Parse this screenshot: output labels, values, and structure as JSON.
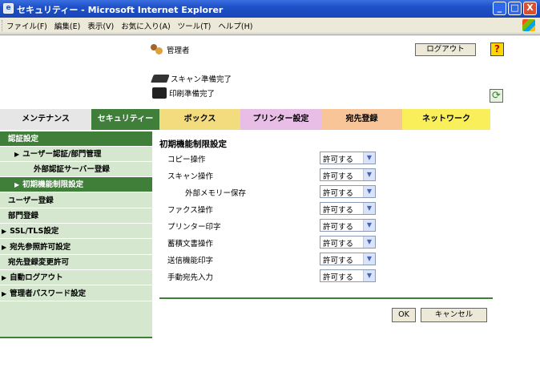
{
  "window": {
    "title": "セキュリティー - Microsoft Internet Explorer",
    "min": "_",
    "max": "□",
    "close": "X"
  },
  "menubar": [
    "ファイル(F)",
    "編集(E)",
    "表示(V)",
    "お気に入り(A)",
    "ツール(T)",
    "ヘルプ(H)"
  ],
  "header": {
    "user": "管理者",
    "logout_label": "ログアウト",
    "help_label": "?",
    "status_scan": "スキャン準備完了",
    "status_print": "印刷準備完了",
    "refresh_glyph": "⟳"
  },
  "tabs": [
    "メンテナンス",
    "セキュリティー",
    "ボックス",
    "プリンター設定",
    "宛先登録",
    "ネットワーク"
  ],
  "active_tab": "セキュリティー",
  "sidebar": [
    {
      "label": "認証設定",
      "dark": true,
      "arrow": ""
    },
    {
      "label": "ユーザー認証/部門管理",
      "dark": false,
      "arrow": "▶"
    },
    {
      "label": "外部認証サーバー登録",
      "dark": false,
      "arrow": ""
    },
    {
      "label": "初期機能制限設定",
      "dark": true,
      "arrow": "▶"
    },
    {
      "label": "ユーザー登録",
      "dark": false,
      "arrow": ""
    },
    {
      "label": "部門登録",
      "dark": false,
      "arrow": ""
    },
    {
      "label": "SSL/TLS設定",
      "dark": false,
      "arrow": "▶"
    },
    {
      "label": "宛先参照許可設定",
      "dark": false,
      "arrow": "▶"
    },
    {
      "label": "宛先登録変更許可",
      "dark": false,
      "arrow": ""
    },
    {
      "label": "自動ログアウト",
      "dark": false,
      "arrow": "▶"
    },
    {
      "label": "管理者パスワード設定",
      "dark": false,
      "arrow": "▶"
    }
  ],
  "main": {
    "title": "初期機能制限設定",
    "rows": [
      {
        "label": "コピー操作",
        "value": "許可する"
      },
      {
        "label": "スキャン操作",
        "value": "許可する"
      },
      {
        "label": "外部メモリー保存",
        "value": "許可する"
      },
      {
        "label": "ファクス操作",
        "value": "許可する"
      },
      {
        "label": "プリンター印字",
        "value": "許可する"
      },
      {
        "label": "蓄積文書操作",
        "value": "許可する"
      },
      {
        "label": "送信機能印字",
        "value": "許可する"
      },
      {
        "label": "手動宛先入力",
        "value": "許可する"
      }
    ],
    "ok_label": "OK",
    "cancel_label": "キャンセル"
  },
  "colors": {
    "accent_green": "#3f7f3a",
    "sidebar_bg": "#d5e8cf",
    "titlebar_blue": "#1e50c8"
  }
}
